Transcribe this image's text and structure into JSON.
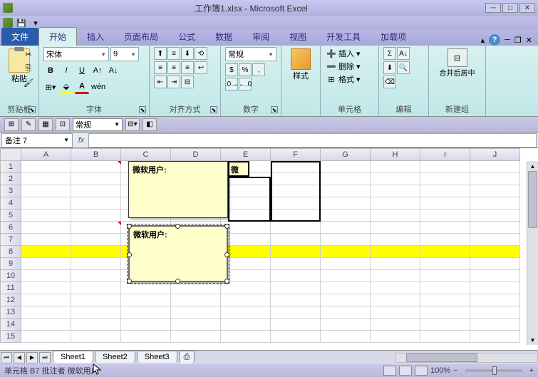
{
  "title": "工作簿1.xlsx - Microsoft Excel",
  "tabs": {
    "file": "文件",
    "home": "开始",
    "insert": "插入",
    "layout": "页面布局",
    "formula": "公式",
    "data": "数据",
    "review": "审阅",
    "view": "视图",
    "dev": "开发工具",
    "addin": "加载项"
  },
  "ribbon": {
    "clipboard": {
      "paste": "粘贴",
      "label": "剪贴板"
    },
    "font": {
      "name": "宋体",
      "size": "9",
      "label": "字体"
    },
    "align": {
      "label": "对齐方式"
    },
    "number": {
      "format": "常规",
      "label": "数字"
    },
    "styles": {
      "btn": "样式",
      "label": ""
    },
    "cells": {
      "insert": "插入",
      "delete": "删除",
      "format": "格式",
      "label": "单元格"
    },
    "edit": {
      "label": "编辑"
    },
    "newgrp": {
      "btn": "合并后居中",
      "label": "新建组"
    }
  },
  "secondbar": {
    "format": "常规"
  },
  "namebox": "备注 7",
  "columns": [
    "A",
    "B",
    "C",
    "D",
    "E",
    "F",
    "G",
    "H",
    "I",
    "J"
  ],
  "rows": [
    "1",
    "2",
    "3",
    "4",
    "5",
    "6",
    "7",
    "8",
    "9",
    "10",
    "11",
    "12",
    "13",
    "14",
    "15"
  ],
  "comments": {
    "c1": "微软用户:",
    "c2": "微",
    "c3": "微软用户:"
  },
  "sheets": {
    "s1": "Sheet1",
    "s2": "Sheet2",
    "s3": "Sheet3"
  },
  "status": {
    "left": "单元格 B7 批注者 微软用户",
    "zoom": "100%"
  }
}
